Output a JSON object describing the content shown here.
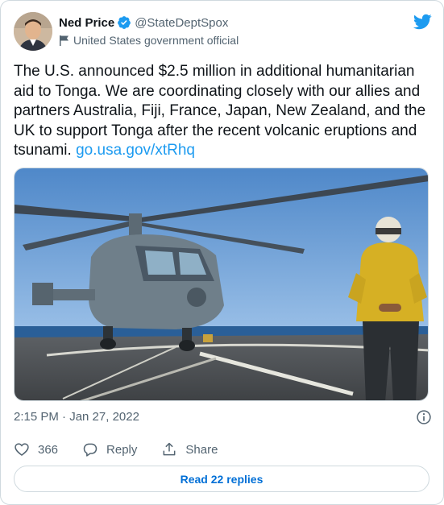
{
  "author": {
    "name": "Ned Price",
    "handle": "@StateDeptSpox",
    "label": "United States government official"
  },
  "tweet": {
    "text": "The U.S. announced $2.5 million in additional humanitarian aid to Tonga. We are coordinating closely with our allies and partners Australia, Fiji, France, Japan, New Zealand, and the UK to support Tonga after the recent volcanic eruptions and tsunami. ",
    "link": "go.usa.gov/xtRhq"
  },
  "timestamp": "2:15 PM · Jan 27, 2022",
  "actions": {
    "like_count": "366",
    "reply_label": "Reply",
    "share_label": "Share"
  },
  "read_replies_label": "Read 22 replies",
  "colors": {
    "accent": "#1d9bf0",
    "text": "#0f1419",
    "secondary": "#536471",
    "border": "#cfd9de"
  },
  "icons": [
    "verified-badge-icon",
    "government-flag-icon",
    "twitter-bird-icon",
    "info-icon",
    "heart-icon",
    "reply-icon",
    "share-icon"
  ]
}
